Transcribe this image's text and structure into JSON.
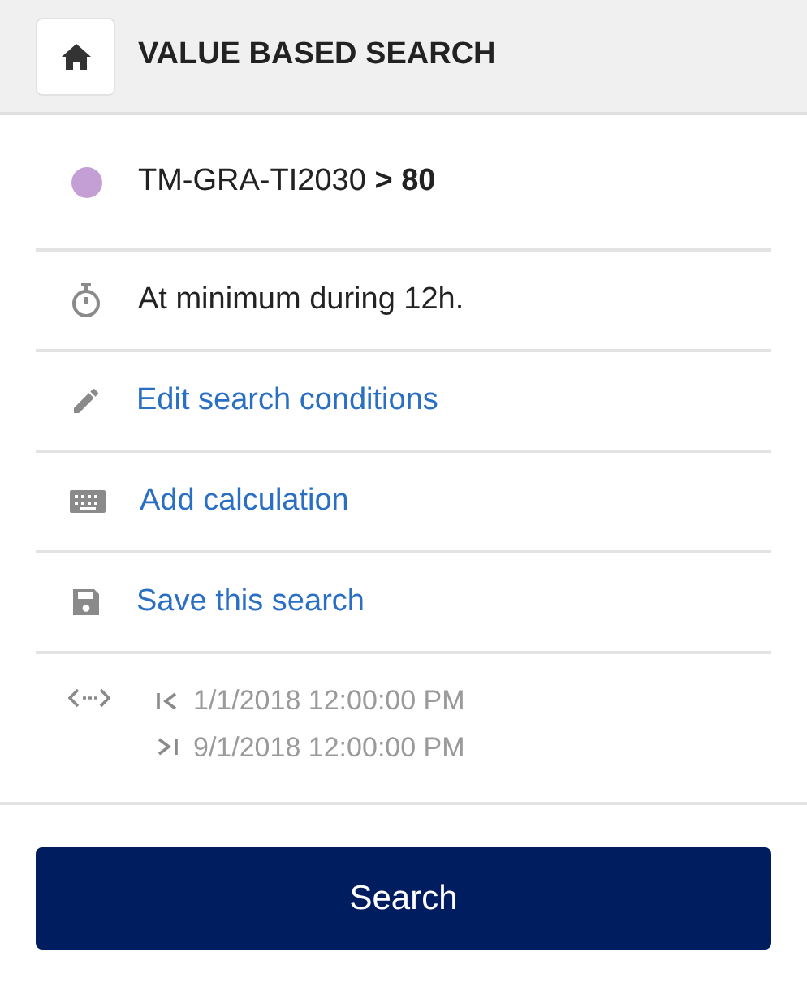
{
  "header": {
    "title": "VALUE BASED SEARCH"
  },
  "condition": {
    "text": "TM-GRA-TI2030 **> 80**",
    "color": "#c49fd6"
  },
  "duration": {
    "text": "At minimum during 12h."
  },
  "actions": [
    {
      "kind": "edit",
      "label": "Edit search conditions"
    },
    {
      "kind": "calculation",
      "label": "Add calculation"
    },
    {
      "kind": "save",
      "label": "Save this search"
    }
  ],
  "range": {
    "start": "1/1/2018 12:00:00 PM",
    "end": "9/1/2018 12:00:00 PM"
  },
  "search_button": "Search"
}
